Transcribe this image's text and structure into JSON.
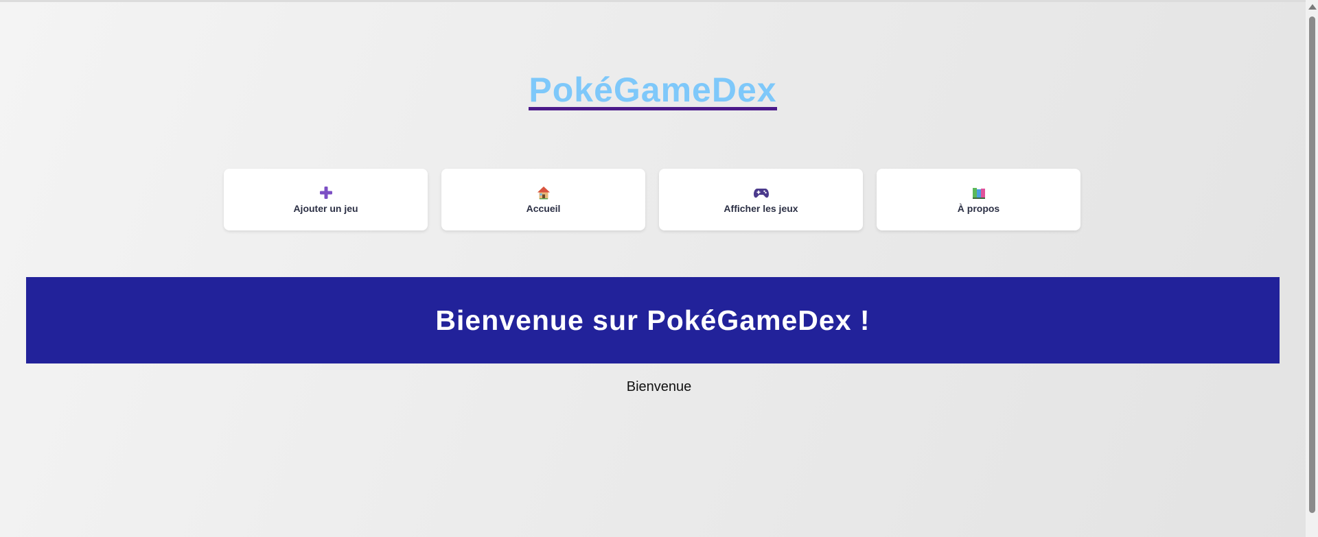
{
  "site": {
    "logo_text": "PokéGameDex",
    "logo_color": "#7ec8fa",
    "logo_underline_color": "#4b1a8a"
  },
  "nav": {
    "items": [
      {
        "icon": "plus-icon",
        "glyph": "➕",
        "label": "Ajouter un jeu"
      },
      {
        "icon": "house-icon",
        "glyph": "🏠",
        "label": "Accueil"
      },
      {
        "icon": "gamepad-icon",
        "glyph": "🎮",
        "label": "Afficher les jeux"
      },
      {
        "icon": "books-icon",
        "glyph": "📚",
        "label": "À propos"
      }
    ]
  },
  "banner": {
    "title": "Bienvenue sur PokéGameDex !",
    "background": "#22229a"
  },
  "main": {
    "welcome_text": "Bienvenue"
  }
}
